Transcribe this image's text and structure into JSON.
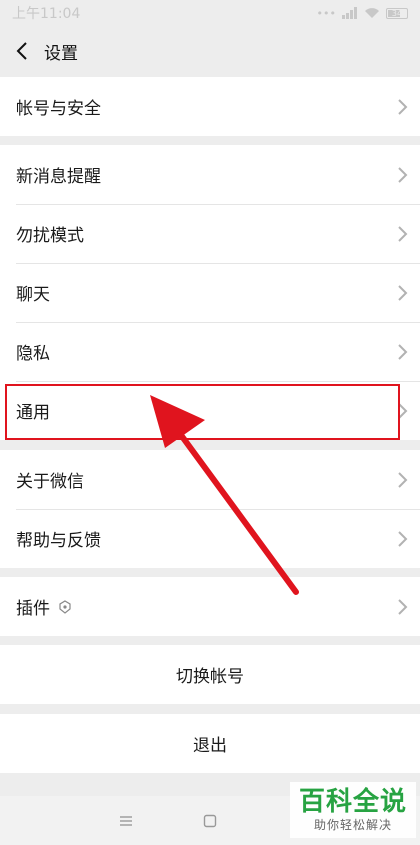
{
  "status_bar": {
    "time": "上午11:04",
    "battery": "34"
  },
  "header": {
    "title": "设置"
  },
  "groups": {
    "account": [
      "帐号与安全"
    ],
    "main": [
      "新消息提醒",
      "勿扰模式",
      "聊天",
      "隐私",
      "通用"
    ],
    "about": [
      "关于微信",
      "帮助与反馈"
    ],
    "plugins": [
      "插件"
    ]
  },
  "actions": {
    "switch_account": "切换帐号",
    "logout": "退出"
  },
  "watermark": {
    "title": "百科全说",
    "subtitle": "助你轻松解决"
  },
  "colors": {
    "highlight": "#e0141e",
    "watermark": "#27a342"
  }
}
